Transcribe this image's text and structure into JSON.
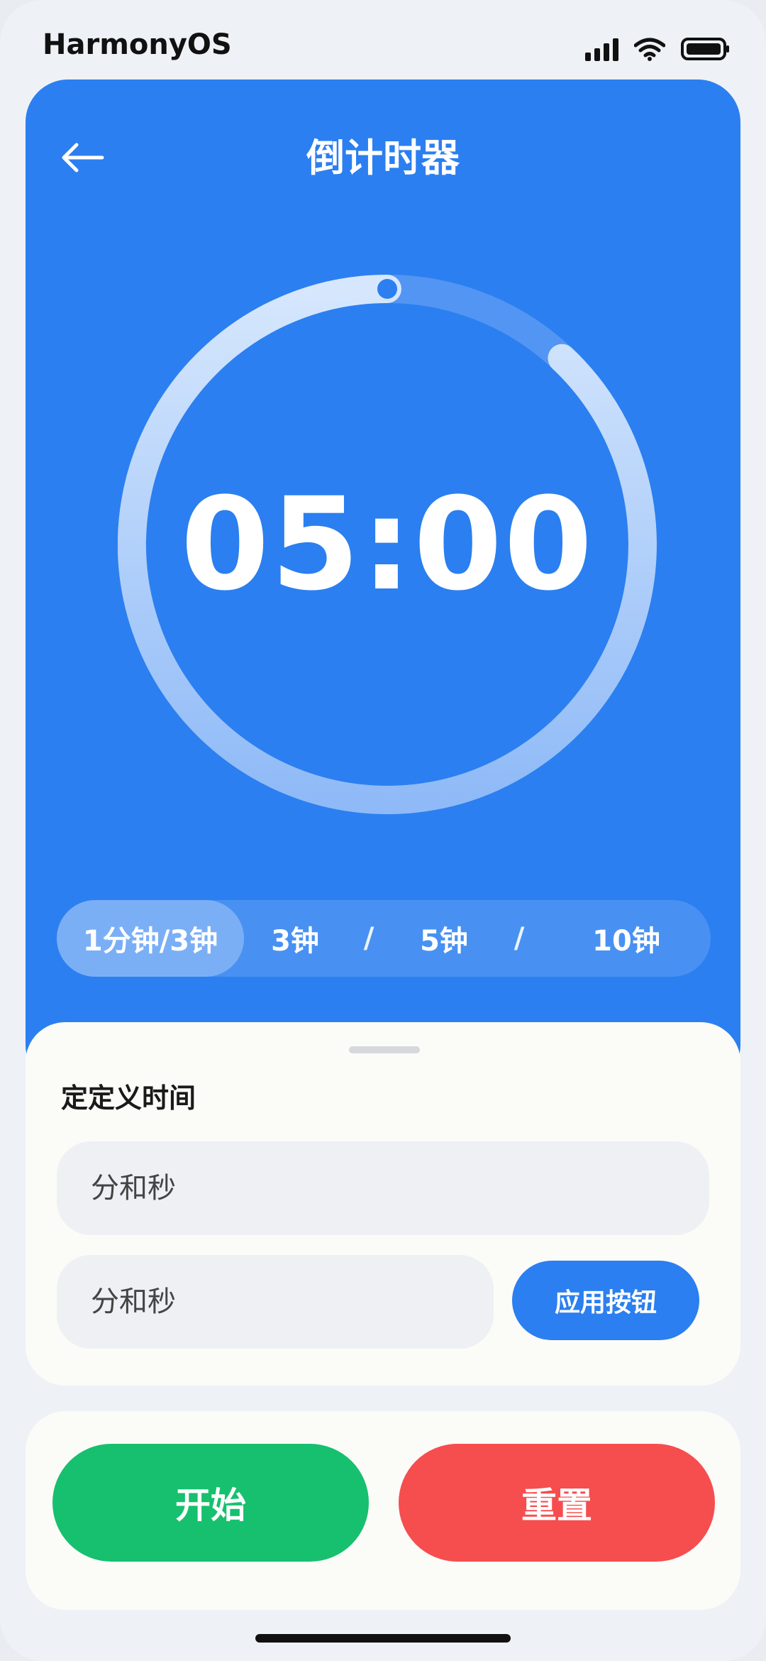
{
  "status_bar": {
    "brand": "HarmonyOS",
    "icons": [
      "signal-icon",
      "wifi-icon",
      "battery-icon"
    ]
  },
  "header": {
    "back_icon": "arrow-left-icon",
    "title": "倒计时器"
  },
  "timer": {
    "display": "05:00",
    "progress": 0.88
  },
  "presets": {
    "items": [
      {
        "label": "1分钟/3钟",
        "active": true
      },
      {
        "label": "3钟",
        "active": false
      },
      {
        "label": "5钟",
        "active": false
      },
      {
        "label": "10钟",
        "active": false
      }
    ],
    "separator": "/"
  },
  "custom": {
    "title": "定定义时间",
    "input1_placeholder": "分和秒",
    "input2_placeholder": "分和秒",
    "apply_label": "应用按钮"
  },
  "actions": {
    "start_label": "开始",
    "reset_label": "重置"
  },
  "colors": {
    "primary": "#2b7ff0",
    "start": "#16c06e",
    "reset": "#f64d4f",
    "card": "#fbfbf8"
  }
}
